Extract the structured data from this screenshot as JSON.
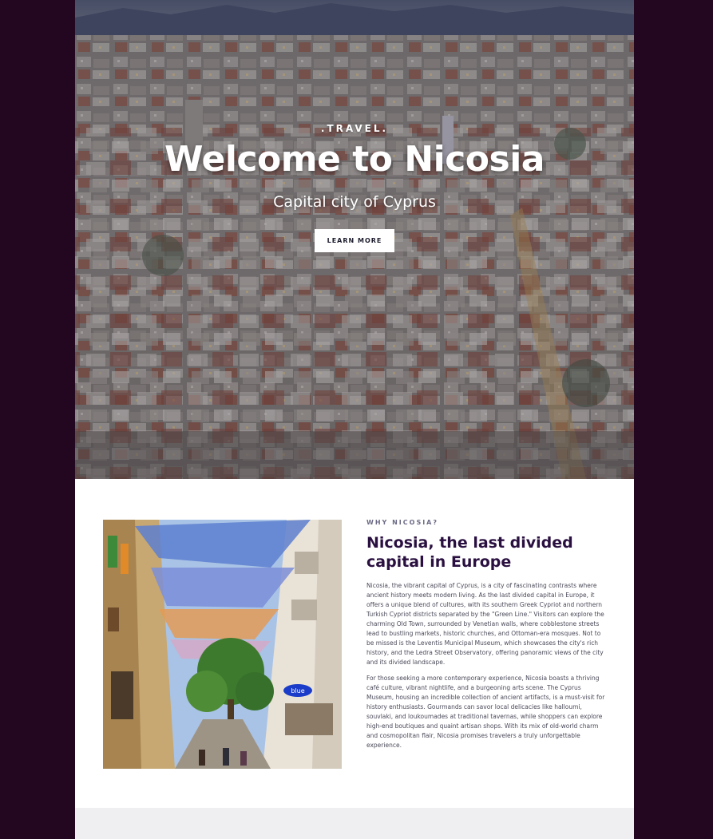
{
  "hero": {
    "eyebrow": ".TRAVEL.",
    "title": "Welcome to Nicosia",
    "subtitle": "Capital city of Cyprus",
    "cta_label": "LEARN MORE"
  },
  "intro": {
    "kicker": "WHY NICOSIA?",
    "title": "Nicosia, the last divided capital in Europe",
    "paragraphs": [
      "Nicosia, the vibrant capital of Cyprus, is a city of fascinating contrasts where ancient history meets modern living. As the last divided capital in Europe, it offers a unique blend of cultures, with its southern Greek Cypriot and northern Turkish Cypriot districts separated by the \"Green Line.\" Visitors can explore the charming Old Town, surrounded by Venetian walls, where cobblestone streets lead to bustling markets, historic churches, and Ottoman-era mosques. Not to be missed is the Leventis Municipal Museum, which showcases the city's rich history, and the Ledra Street Observatory, offering panoramic views of the city and its divided landscape.",
      "For those seeking a more contemporary experience, Nicosia boasts a thriving café culture, vibrant nightlife, and a burgeoning arts scene. The Cyprus Museum, housing an incredible collection of ancient artifacts, is a must-visit for history enthusiasts. Gourmands can savor local delicacies like halloumi, souvlaki, and loukoumades at traditional tavernas, while shoppers can explore high-end boutiques and quaint artisan shops. With its mix of old-world charm and cosmopolitan flair, Nicosia promises travelers a truly unforgettable experience."
    ],
    "photo_sign": "blue"
  },
  "colors": {
    "page_bg": "#23061f",
    "heading": "#2a1040",
    "kicker": "#6b6a86"
  }
}
